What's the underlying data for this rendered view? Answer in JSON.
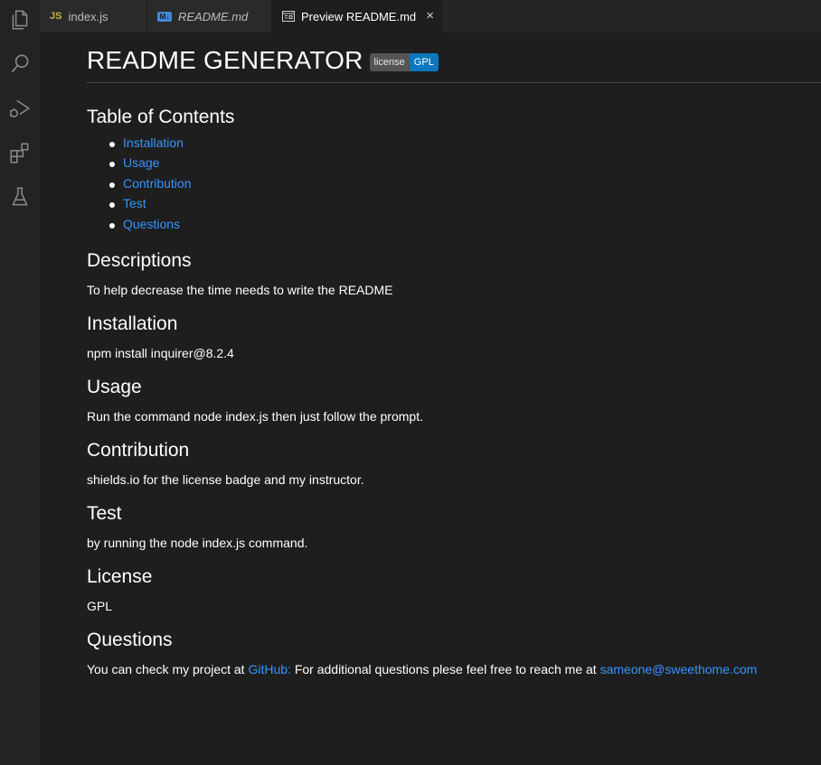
{
  "tabs": [
    {
      "icon": "JS",
      "label": "index.js",
      "active": false,
      "italic": false
    },
    {
      "icon": "M↓",
      "label": "README.md",
      "active": false,
      "italic": true
    },
    {
      "icon": "preview-icon",
      "label": "Preview README.md",
      "active": true,
      "italic": false
    }
  ],
  "activity_bar": [
    "explorer-icon",
    "search-icon",
    "run-debug-icon",
    "extensions-icon",
    "testing-icon"
  ],
  "readme": {
    "title": "README GENERATOR",
    "badge": {
      "left": "license",
      "right": "GPL"
    },
    "toc_heading": "Table of Contents",
    "toc": [
      "Installation",
      "Usage",
      "Contribution",
      "Test",
      "Questions"
    ],
    "sections": {
      "description": {
        "heading": "Descriptions",
        "text": "To help decrease the time needs to write the README"
      },
      "installation": {
        "heading": "Installation",
        "text": "npm install inquirer@8.2.4"
      },
      "usage": {
        "heading": "Usage",
        "text": "Run the command node index.js then just follow the prompt."
      },
      "contribution": {
        "heading": "Contribution",
        "text": "shields.io for the license badge and my instructor."
      },
      "test": {
        "heading": "Test",
        "text": "by running the node index.js command."
      },
      "license": {
        "heading": "License",
        "text": "GPL"
      },
      "questions": {
        "heading": "Questions",
        "text_before": "You can check my project at ",
        "github_link": "GitHub:",
        "text_middle": " For additional questions plese feel free to reach me at ",
        "email_link": "sameone@sweethome.com"
      }
    }
  },
  "colors": {
    "link": "#3794ff",
    "badge_right": "#0b78bd",
    "background": "#1e1e1e"
  }
}
